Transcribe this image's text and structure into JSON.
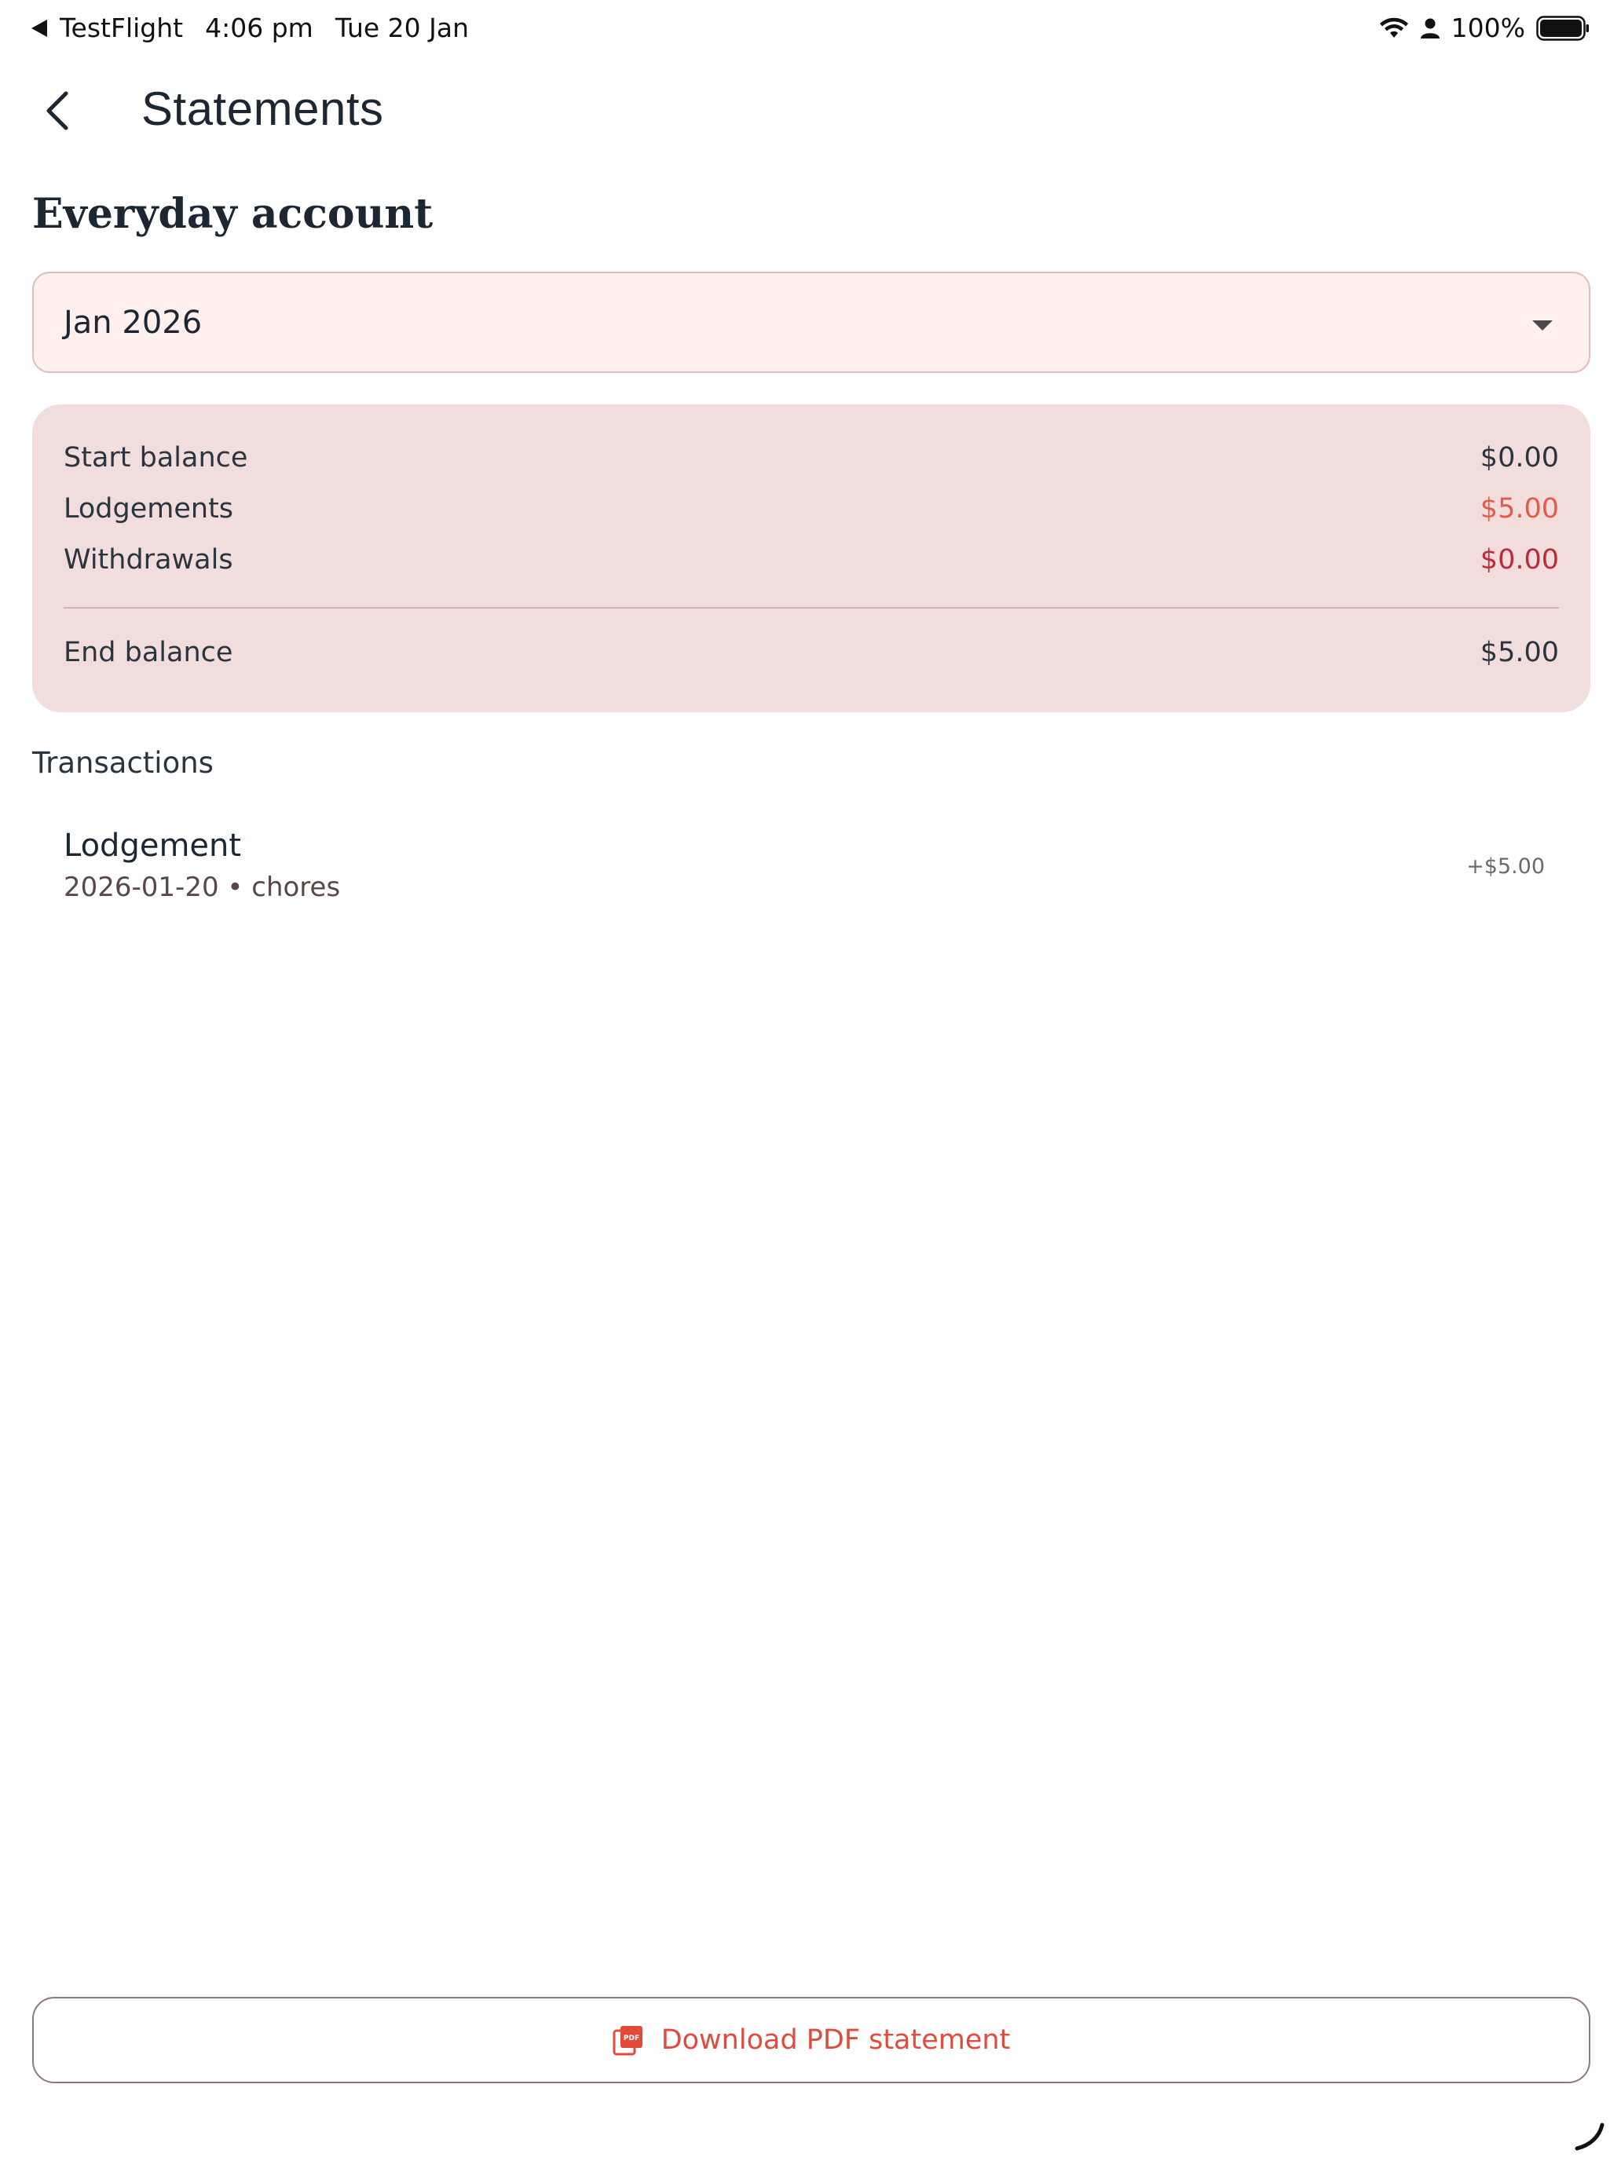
{
  "status_bar": {
    "back_app": "TestFlight",
    "time": "4:06 pm",
    "date": "Tue 20 Jan",
    "battery": "100%"
  },
  "header": {
    "title": "Statements",
    "back_icon": "chevron-left-icon"
  },
  "account": {
    "name": "Everyday account"
  },
  "month_select": {
    "value": "Jan 2026"
  },
  "summary": {
    "start_label": "Start balance",
    "start_value": "$0.00",
    "lodgements_label": "Lodgements",
    "lodgements_value": "$5.00",
    "withdrawals_label": "Withdrawals",
    "withdrawals_value": "$0.00",
    "end_label": "End balance",
    "end_value": "$5.00"
  },
  "transactions": {
    "label": "Transactions",
    "items": [
      {
        "title": "Lodgement",
        "meta": "2026-01-20 • chores",
        "amount": "+$5.00"
      }
    ]
  },
  "actions": {
    "download_label": "Download PDF statement"
  },
  "colors": {
    "accent": "#e24a3b",
    "lodgement": "#e65a4a",
    "withdrawal": "#c2283a",
    "card_bg": "#f0dddc",
    "select_bg": "#fff0ee"
  }
}
